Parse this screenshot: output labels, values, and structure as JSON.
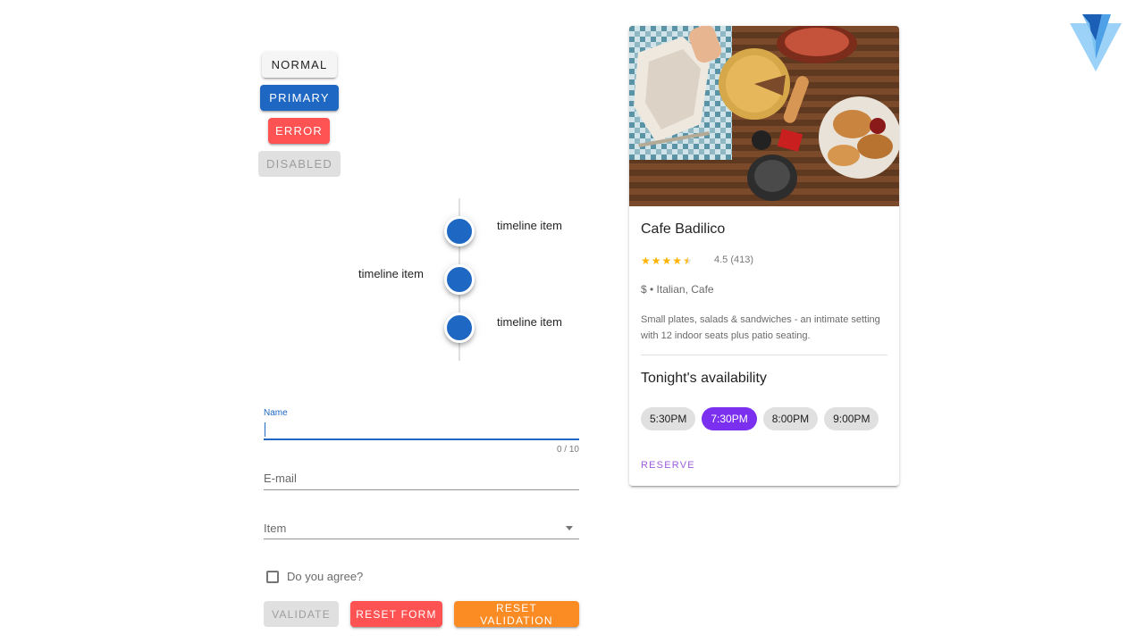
{
  "buttons": {
    "normal": "NORMAL",
    "primary": "PRIMARY",
    "error": "ERROR",
    "disabled": "DISABLED"
  },
  "timeline": {
    "items": [
      "timeline item",
      "timeline item",
      "timeline item"
    ]
  },
  "form": {
    "name": {
      "label": "Name",
      "value": "",
      "counter": "0 / 10"
    },
    "email": {
      "label": "E-mail",
      "value": ""
    },
    "item": {
      "label": "Item",
      "selected": ""
    },
    "agree": {
      "label": "Do you agree?",
      "checked": false
    },
    "actions": {
      "validate": "VALIDATE",
      "reset": "RESET FORM",
      "reset_validation": "RESET VALIDATION"
    }
  },
  "card": {
    "title": "Cafe Badilico",
    "rating": 4.5,
    "rating_text": "4.5 (413)",
    "meta": "$ • Italian, Cafe",
    "description": "Small plates, salads & sandwiches - an intimate setting with 12 indoor seats plus patio seating.",
    "subtitle": "Tonight's availability",
    "times": [
      "5:30PM",
      "7:30PM",
      "8:00PM",
      "9:00PM"
    ],
    "selected_time": "7:30PM",
    "action": "RESERVE"
  },
  "colors": {
    "primary": "#1e67c3",
    "error": "#ff5252",
    "warning": "#fb8c24",
    "chip_active": "#7b30f0",
    "reserve": "#9c5bdb",
    "star": "#ffb300"
  },
  "icons": {
    "logo": "vuetify-logo-icon",
    "select_arrow": "caret-down-icon",
    "star": "star-icon"
  }
}
